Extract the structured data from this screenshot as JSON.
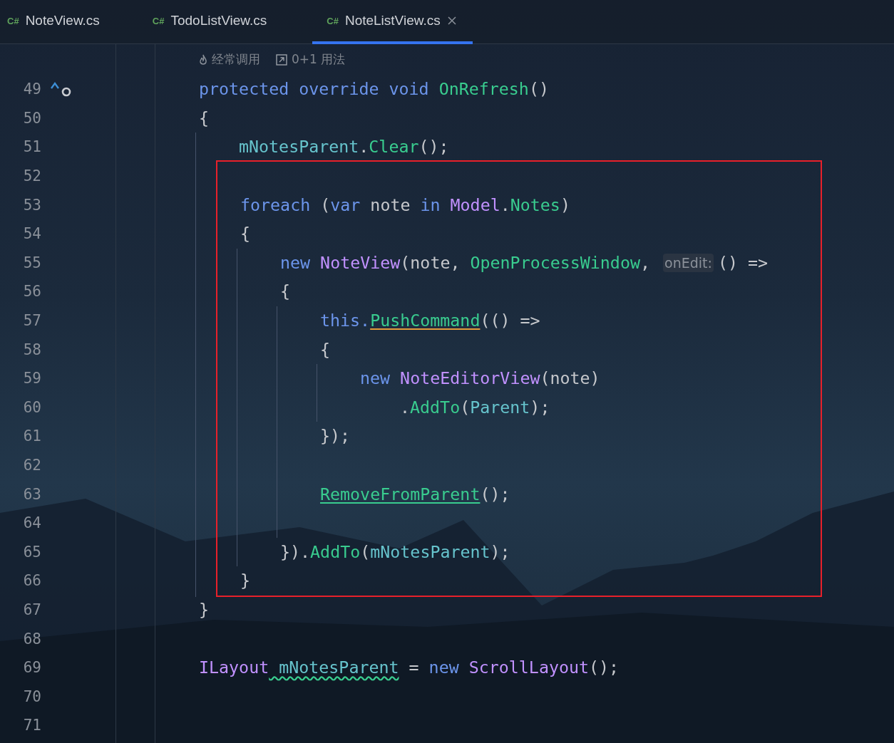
{
  "tabs": [
    {
      "icon_text": "C#",
      "label": "NoteView.cs",
      "selected": false
    },
    {
      "icon_text": "C#",
      "label": "TodoListView.cs",
      "selected": false
    },
    {
      "icon_text": "C#",
      "label": "NoteListView.cs",
      "selected": true,
      "closable": true
    }
  ],
  "code_vision": [
    {
      "kind": "flame",
      "text": "经常调用"
    },
    {
      "kind": "usages",
      "text": "0+1 用法"
    }
  ],
  "lines": [
    {
      "kind": "line",
      "number": "49",
      "override_marker": true,
      "implementation_marker": true,
      "code": [
        {
          "kind": "keyword",
          "text": "protected override void"
        },
        {
          "kind": "method",
          "text": " OnRefresh"
        },
        {
          "kind": "plain",
          "text": "()"
        }
      ]
    },
    {
      "kind": "line",
      "number": "50",
      "code": [
        {
          "kind": "plain",
          "text": "{"
        }
      ],
      "children": [
        {
          "kind": "line",
          "number": "51",
          "code": [
            {
              "kind": "field",
              "text": "mNotesParent"
            },
            {
              "kind": "plain",
              "text": "."
            },
            {
              "kind": "method",
              "text": "Clear"
            },
            {
              "kind": "plain",
              "text": "();"
            }
          ]
        },
        {
          "kind": "highlight",
          "children": [
            {
              "kind": "line",
              "number": "52"
            },
            {
              "kind": "line",
              "number": "53",
              "code": [
                {
                  "kind": "keyword",
                  "text": "foreach"
                },
                {
                  "kind": "plain",
                  "text": " ("
                },
                {
                  "kind": "keyword",
                  "text": "var"
                },
                {
                  "kind": "plain",
                  "text": " note "
                },
                {
                  "kind": "keyword",
                  "text": "in"
                },
                {
                  "kind": "type",
                  "text": " Model"
                },
                {
                  "kind": "plain",
                  "text": "."
                },
                {
                  "kind": "method",
                  "text": "Notes"
                },
                {
                  "kind": "plain",
                  "text": ")"
                }
              ]
            },
            {
              "kind": "line",
              "number": "54",
              "code": [
                {
                  "kind": "plain",
                  "text": "{"
                }
              ],
              "children": [
                {
                  "kind": "line",
                  "number": "55",
                  "code": [
                    {
                      "kind": "keyword",
                      "text": "new"
                    },
                    {
                      "kind": "type",
                      "text": " NoteView"
                    },
                    {
                      "kind": "plain",
                      "text": "(note, "
                    },
                    {
                      "kind": "method",
                      "text": "OpenProcessWindow"
                    },
                    {
                      "kind": "plain",
                      "text": ", "
                    },
                    {
                      "kind": "hint",
                      "text": "onEdit:"
                    },
                    {
                      "kind": "plain",
                      "text": "() =>"
                    }
                  ]
                },
                {
                  "kind": "line",
                  "number": "56",
                  "code": [
                    {
                      "kind": "plain",
                      "text": "{"
                    }
                  ],
                  "children": [
                    {
                      "kind": "line",
                      "number": "57",
                      "code": [
                        {
                          "kind": "keyword",
                          "text": "this."
                        },
                        {
                          "kind": "method",
                          "text": "PushCommand",
                          "warning": true
                        },
                        {
                          "kind": "plain",
                          "text": "(() =>"
                        }
                      ]
                    },
                    {
                      "kind": "line",
                      "number": "58",
                      "code": [
                        {
                          "kind": "plain",
                          "text": "{"
                        }
                      ],
                      "children": [
                        {
                          "kind": "line",
                          "number": "59",
                          "code": [
                            {
                              "kind": "keyword",
                              "text": "new"
                            },
                            {
                              "kind": "type",
                              "text": " NoteEditorView"
                            },
                            {
                              "kind": "plain",
                              "text": "(note)"
                            }
                          ],
                          "continuation": {
                            "number": "60",
                            "code": [
                              {
                                "kind": "plain",
                                "text": "."
                              },
                              {
                                "kind": "method",
                                "text": "AddTo"
                              },
                              {
                                "kind": "plain",
                                "text": "("
                              },
                              {
                                "kind": "field",
                                "text": "Parent"
                              },
                              {
                                "kind": "plain",
                                "text": ");"
                              }
                            ]
                          }
                        }
                      ]
                    },
                    {
                      "kind": "line",
                      "number": "61",
                      "code": [
                        {
                          "kind": "plain",
                          "text": "});"
                        }
                      ]
                    },
                    {
                      "kind": "line",
                      "number": "62"
                    },
                    {
                      "kind": "line",
                      "number": "63",
                      "code": [
                        {
                          "kind": "method",
                          "text": "RemoveFromParent",
                          "usage": true
                        },
                        {
                          "kind": "plain",
                          "text": "();"
                        }
                      ]
                    },
                    {
                      "kind": "line",
                      "number": "64"
                    }
                  ]
                },
                {
                  "kind": "line",
                  "number": "65",
                  "code": [
                    {
                      "kind": "plain",
                      "text": "})."
                    },
                    {
                      "kind": "method",
                      "text": "AddTo"
                    },
                    {
                      "kind": "plain",
                      "text": "("
                    },
                    {
                      "kind": "field",
                      "text": "mNotesParent"
                    },
                    {
                      "kind": "plain",
                      "text": ");"
                    }
                  ]
                }
              ]
            },
            {
              "kind": "line",
              "number": "66",
              "code": [
                {
                  "kind": "plain",
                  "text": "}"
                }
              ]
            }
          ]
        }
      ]
    },
    {
      "kind": "line",
      "number": "67",
      "code": [
        {
          "kind": "plain",
          "text": "}"
        }
      ]
    },
    {
      "kind": "line",
      "number": "68"
    },
    {
      "kind": "line",
      "number": "69",
      "code": [
        {
          "kind": "type",
          "text": "ILayout"
        },
        {
          "kind": "field",
          "text": " mNotesParent",
          "typo": true
        },
        {
          "kind": "plain",
          "text": " = "
        },
        {
          "kind": "keyword",
          "text": "new"
        },
        {
          "kind": "type",
          "text": " ScrollLayout"
        },
        {
          "kind": "plain",
          "text": "();"
        }
      ]
    },
    {
      "kind": "line",
      "number": "70"
    },
    {
      "kind": "line",
      "number": "71"
    }
  ]
}
